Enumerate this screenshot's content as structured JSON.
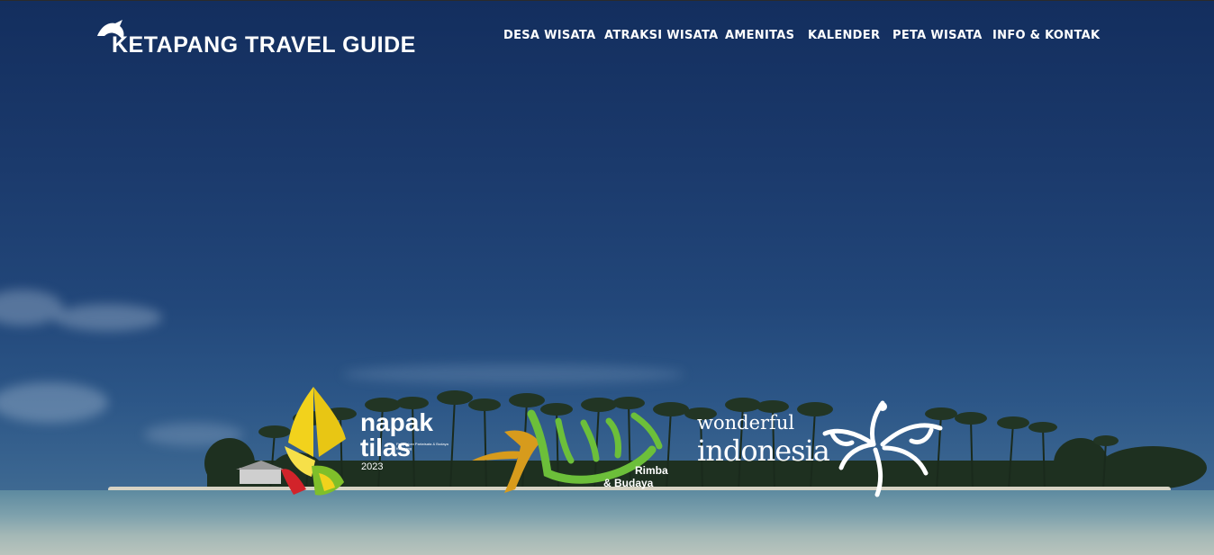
{
  "site": {
    "logo_text": "KETAPANG TRAVEL GUIDE"
  },
  "nav": {
    "items": [
      {
        "label": "DESA WISATA"
      },
      {
        "label": "ATRAKSI WISATA"
      },
      {
        "label": "AMENITAS"
      },
      {
        "label": "KALENDER"
      },
      {
        "label": "PETA WISATA"
      },
      {
        "label": "INFO & KONTAK"
      }
    ]
  },
  "hero": {
    "logos": {
      "napak_tilas": {
        "line1": "napak",
        "line2": "tilas",
        "year": "2023",
        "subtitle": "Penjejakan Pariwisata & Budaya Ketapang"
      },
      "kalbar": {
        "tagline_1": "Rimba",
        "tagline_2": "& Budaya"
      },
      "wonderful_indonesia": {
        "line1": "wonderful",
        "line2": "indonesia"
      }
    }
  },
  "colors": {
    "sky_top": "#132e5e",
    "sky_bottom": "#4d7896",
    "nav_text": "#ffffff",
    "napak_yellow": "#f2d21c",
    "napak_red": "#d2232a",
    "kalbar_green": "#6cbf3a",
    "kalbar_gold": "#d79b1c"
  },
  "icons": [
    "hornbill-logo-icon",
    "napak-tilas-emblem",
    "kalbar-calligraphy-logo",
    "garuda-wonderful-indonesia-emblem"
  ]
}
